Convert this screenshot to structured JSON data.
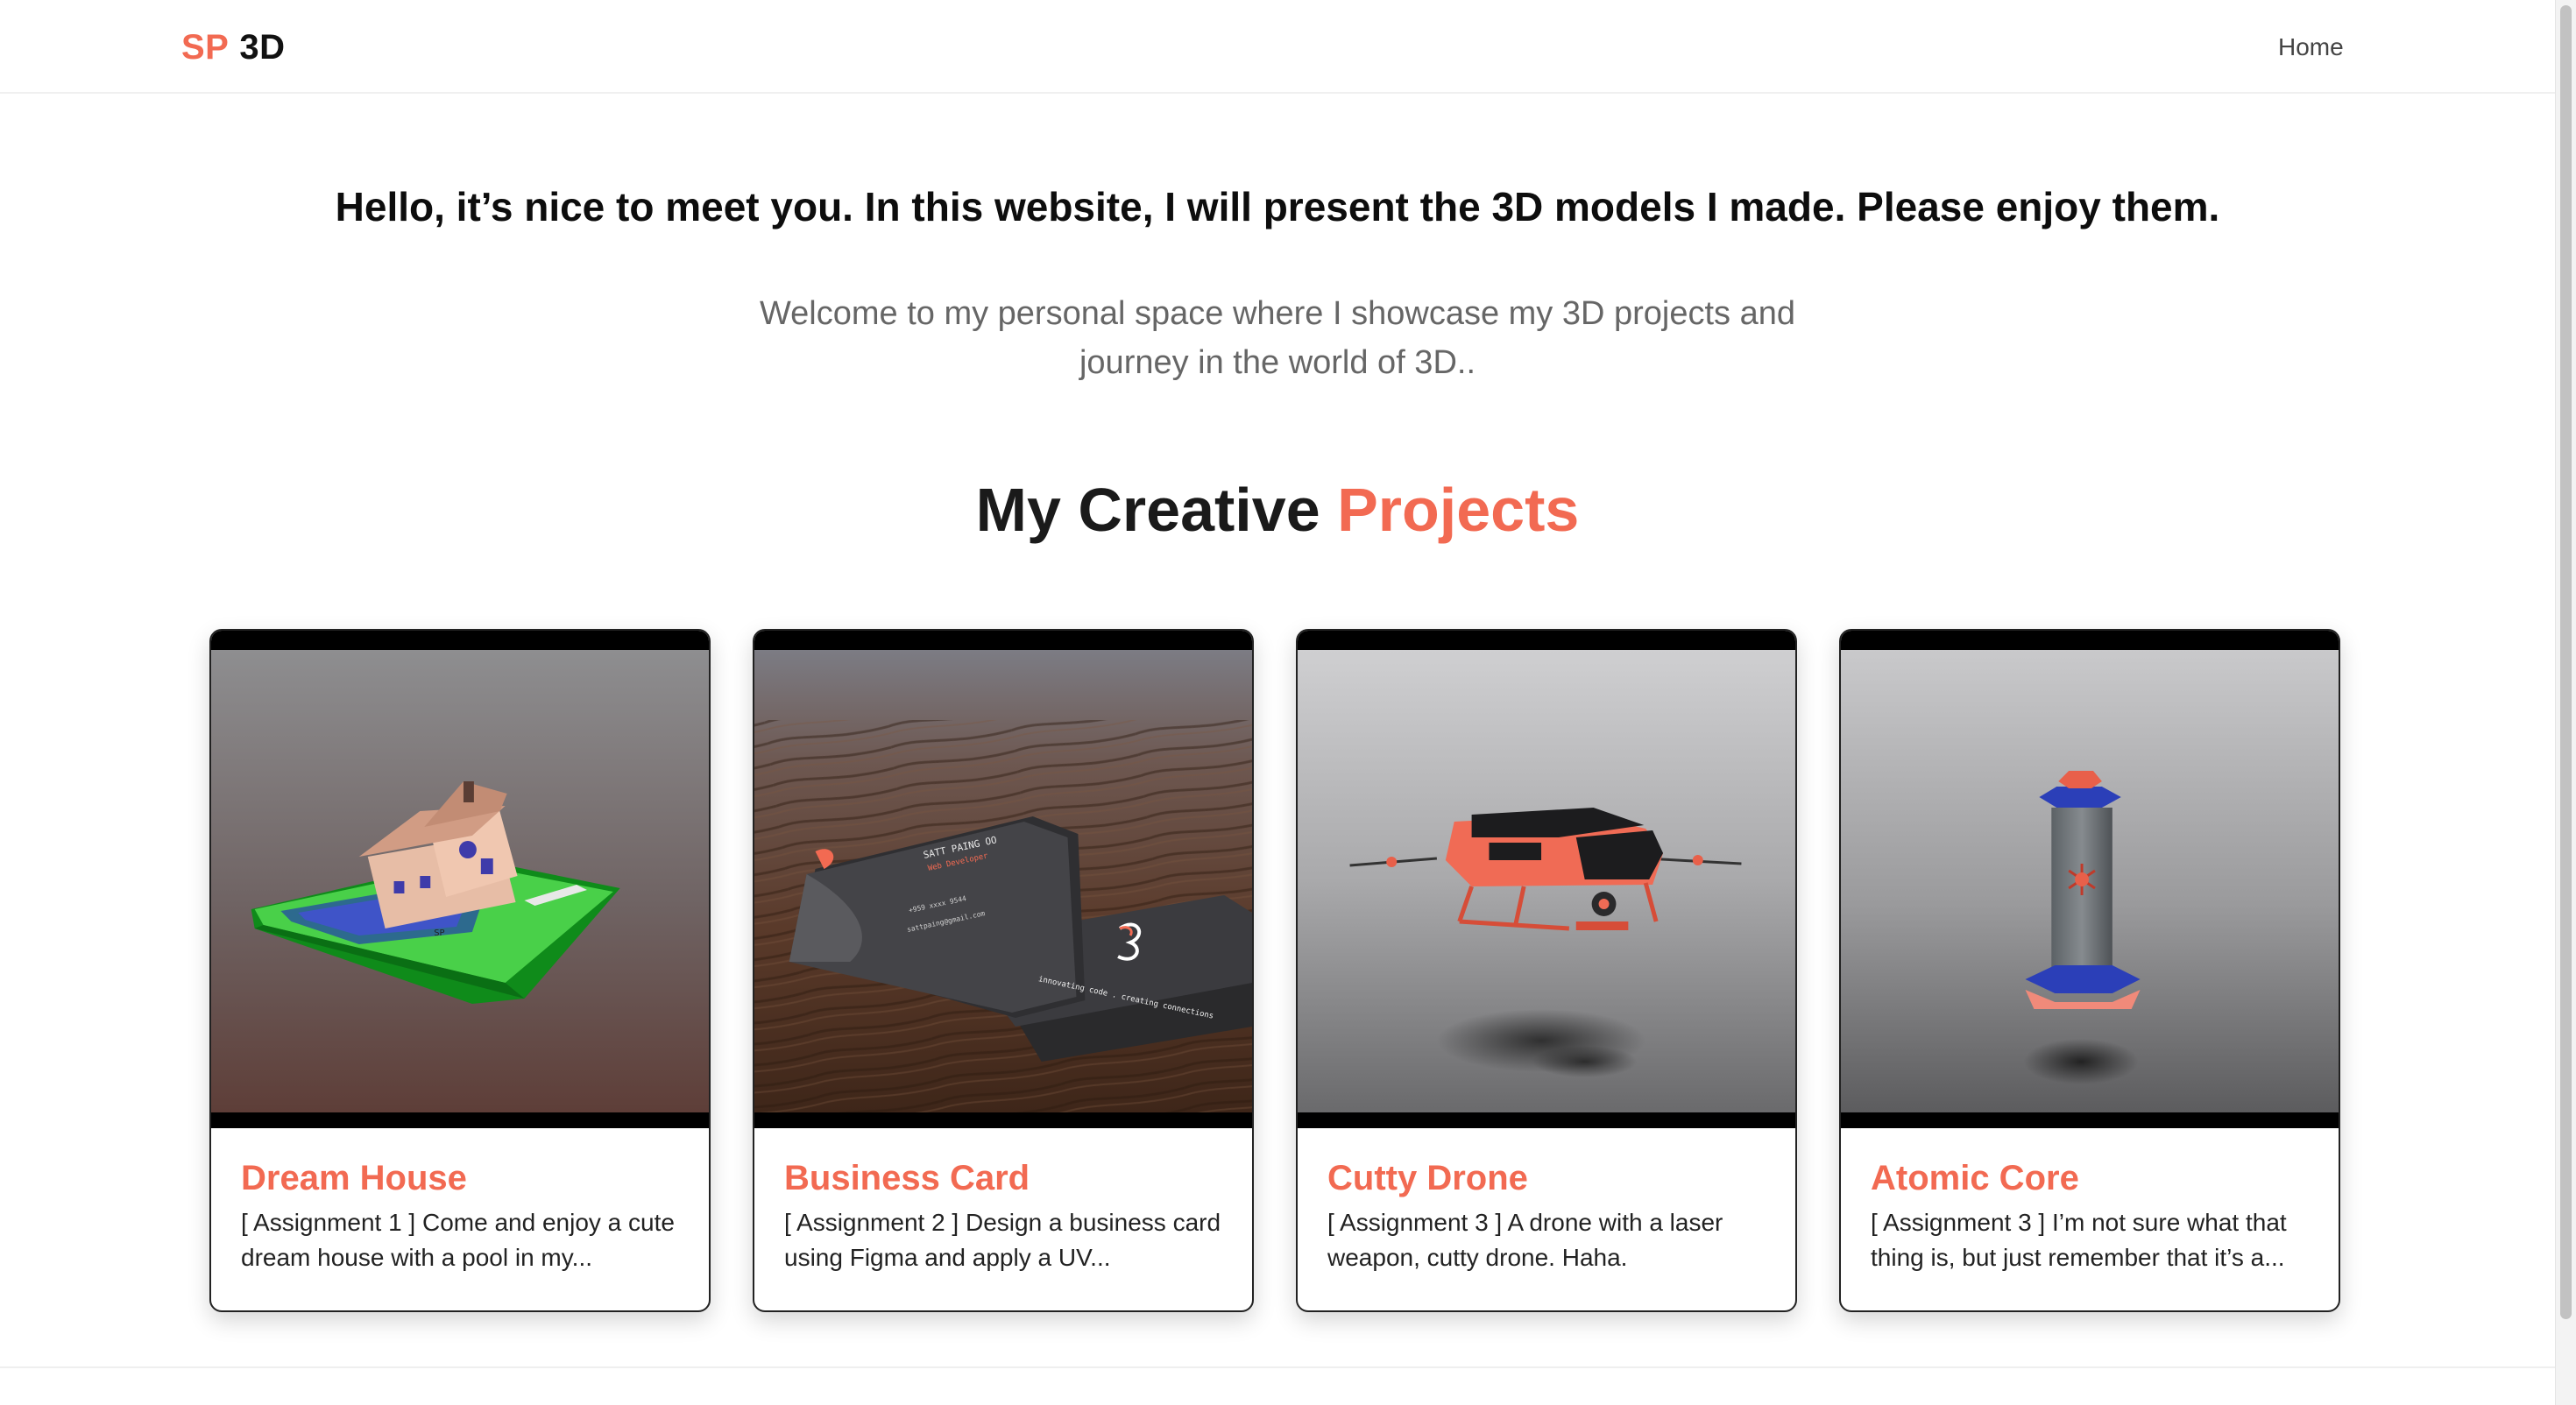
{
  "nav": {
    "logo_accent": "SP",
    "logo_rest": "3D",
    "home_label": "Home"
  },
  "hero": {
    "title": "Hello, it’s nice to meet you. In this website, I will present the 3D models I made. Please enjoy them.",
    "subtitle": "Welcome to my personal space where I showcase my 3D projects and journey in the world of 3D.."
  },
  "projects": {
    "heading_main": "My Creative",
    "heading_accent": "Projects",
    "items": [
      {
        "title": "Dream House",
        "description": "[ Assignment 1 ] Come and enjoy a cute dream house with a pool in my...",
        "image_icon": "house-model-image"
      },
      {
        "title": "Business Card",
        "description": "[ Assignment 2 ] Design a business card using Figma and apply a UV...",
        "image_icon": "business-card-model-image",
        "card_text": {
          "name": "SATT PAING OO",
          "role": "Web Developer",
          "email": "sattpaing@gmail.com",
          "phone": "+959 xxxx 9544",
          "tagline": "innovating code . creating connections"
        }
      },
      {
        "title": "Cutty Drone",
        "description": "[ Assignment 3 ] A drone with a laser weapon, cutty drone. Haha.",
        "image_icon": "drone-model-image"
      },
      {
        "title": "Atomic Core",
        "description": "[ Assignment 3 ] I’m not sure what that thing is, but just remember that it’s a...",
        "image_icon": "atomic-core-model-image"
      }
    ]
  },
  "colors": {
    "accent": "#f26a52",
    "text": "#111111",
    "muted": "#666666"
  }
}
